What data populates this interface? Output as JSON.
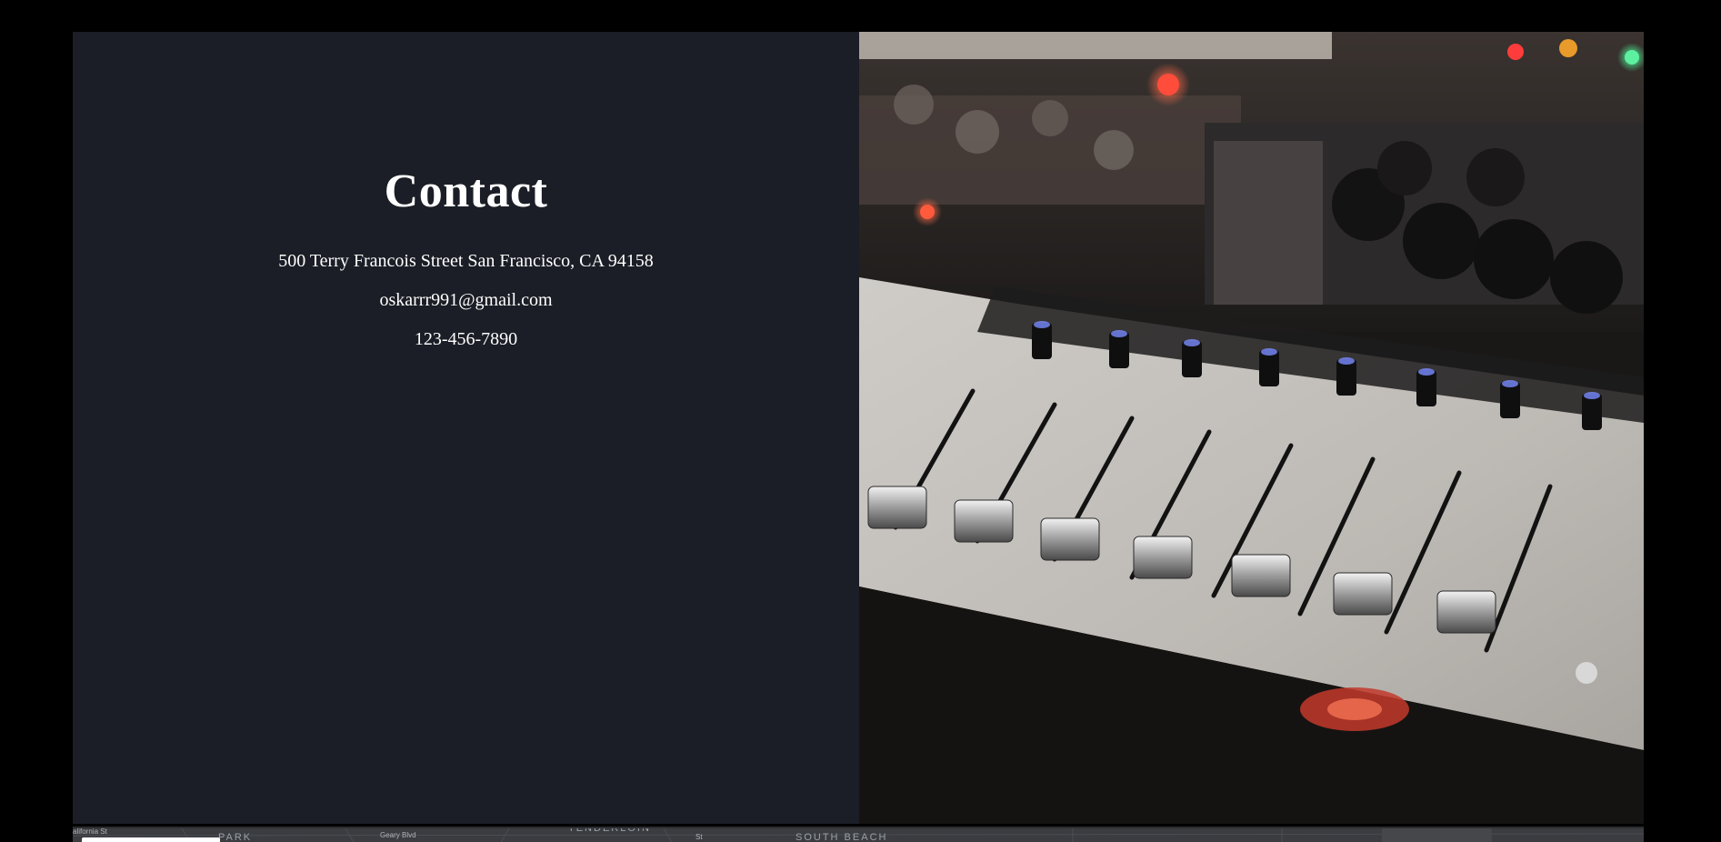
{
  "contact": {
    "title": "Contact",
    "address": "500 Terry Francois Street San Francisco, CA 94158",
    "email": "oskarrr991@gmail.com",
    "phone": "123-456-7890"
  },
  "map": {
    "labels": {
      "california_st": "alifornia St",
      "park": "PARK",
      "geary_blvd": "Geary Blvd",
      "tenderloin": "TENDERLOIN",
      "south_beach": "SOUTH BEACH",
      "street_a": "St"
    }
  },
  "colors": {
    "page_background": "#000000",
    "contact_panel": "#1b1e26",
    "contact_text": "#ffffff",
    "map_background": "#3a3c40"
  }
}
